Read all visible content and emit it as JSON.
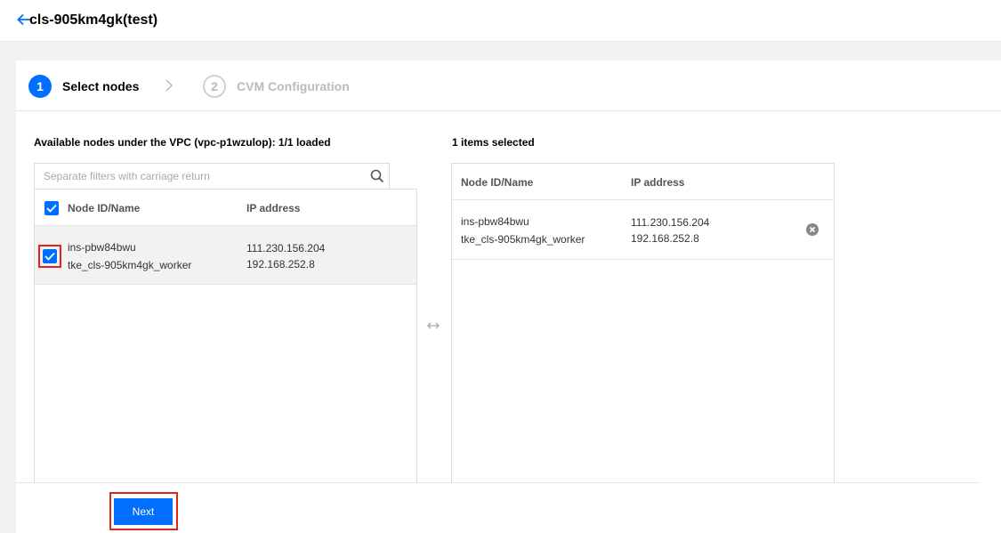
{
  "header": {
    "title": "cls-905km4gk(test)"
  },
  "steps": [
    {
      "number": "1",
      "label": "Select nodes"
    },
    {
      "number": "2",
      "label": "CVM Configuration"
    }
  ],
  "left_list": {
    "heading": "Available nodes under the VPC (vpc-p1wzulop): 1/1 loaded",
    "search_placeholder": "Separate filters with carriage return",
    "columns": [
      "Node ID/Name",
      "IP address"
    ],
    "rows": [
      {
        "id": "ins-pbw84bwu",
        "name": "tke_cls-905km4gk_worker",
        "public_ip": "111.230.156.204",
        "private_ip": "192.168.252.8",
        "checked": true
      }
    ]
  },
  "right_list": {
    "heading": "1 items selected",
    "columns": [
      "Node ID/Name",
      "IP address"
    ],
    "rows": [
      {
        "id": "ins-pbw84bwu",
        "name": "tke_cls-905km4gk_worker",
        "public_ip": "111.230.156.204",
        "private_ip": "192.168.252.8"
      }
    ]
  },
  "footer": {
    "next_label": "Next"
  },
  "colors": {
    "primary": "#006eff",
    "highlight": "#e1251b"
  },
  "icons": [
    "back-arrow-icon",
    "chevron-right-icon",
    "search-icon",
    "check-icon",
    "swap-arrows-icon",
    "remove-circle-icon"
  ]
}
